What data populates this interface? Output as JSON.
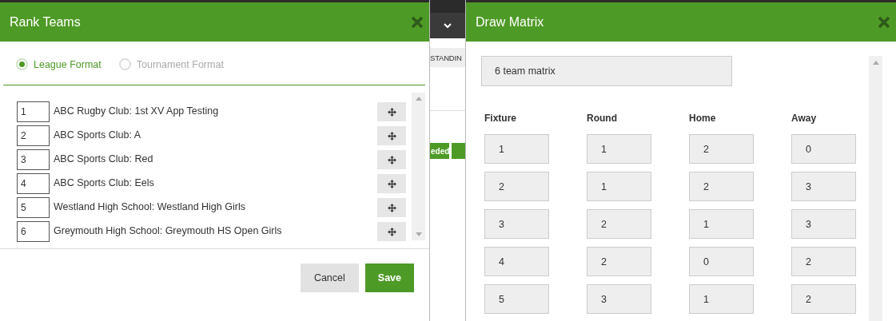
{
  "rank_dialog": {
    "title": "Rank Teams",
    "formats": [
      {
        "label": "League Format",
        "selected": true
      },
      {
        "label": "Tournament Format",
        "selected": false
      }
    ],
    "teams": [
      {
        "rank": "1",
        "name": "ABC Rugby Club: 1st XV App Testing"
      },
      {
        "rank": "2",
        "name": "ABC Sports Club: A"
      },
      {
        "rank": "3",
        "name": "ABC Sports Club: Red"
      },
      {
        "rank": "4",
        "name": "ABC Sports Club: Eels"
      },
      {
        "rank": "5",
        "name": "Westland High School: Westland High Girls"
      },
      {
        "rank": "6",
        "name": "Greymouth High School: Greymouth HS Open Girls"
      }
    ],
    "buttons": [
      {
        "label": "Cancel",
        "kind": "secondary"
      },
      {
        "label": "Save",
        "kind": "primary"
      }
    ]
  },
  "background_page": {
    "tab_label": "STANDIN",
    "button_label": "eded"
  },
  "matrix_dialog": {
    "title": "Draw Matrix",
    "matrix_select": "6 team matrix",
    "columns": [
      "Fixture",
      "Round",
      "Home",
      "Away"
    ],
    "rows": [
      [
        "1",
        "1",
        "2",
        "0"
      ],
      [
        "2",
        "1",
        "2",
        "3"
      ],
      [
        "3",
        "2",
        "1",
        "3"
      ],
      [
        "4",
        "2",
        "0",
        "2"
      ],
      [
        "5",
        "3",
        "1",
        "2"
      ]
    ]
  }
}
